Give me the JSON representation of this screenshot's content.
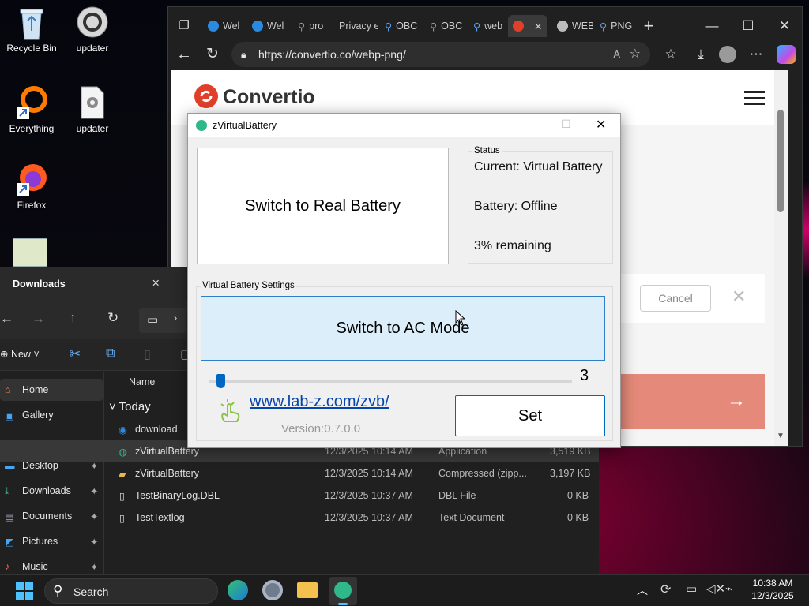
{
  "desktop": {
    "icons": [
      {
        "label": "Recycle Bin"
      },
      {
        "label": "updater"
      },
      {
        "label": "Everything"
      },
      {
        "label": "updater"
      },
      {
        "label": "Firefox"
      }
    ]
  },
  "browser": {
    "tabs": [
      {
        "label": "Wel"
      },
      {
        "label": "Wel"
      },
      {
        "label": "pro"
      },
      {
        "label": "Privacy e"
      },
      {
        "label": "OBC"
      },
      {
        "label": "OBC"
      },
      {
        "label": "web"
      },
      {
        "label": "WEB"
      },
      {
        "label": "PNG"
      }
    ],
    "url": "https://convertio.co/webp-png/",
    "page": {
      "brand": "Convertio",
      "cancel_label": "Cancel"
    }
  },
  "zvb": {
    "title": "zVirtualBattery",
    "switch_battery_label": "Switch to Real Battery",
    "status": {
      "group_label": "Status",
      "current": "Current: Virtual Battery",
      "battery": "Battery: Offline",
      "remaining": "3% remaining"
    },
    "settings": {
      "group_label": "Virtual Battery Settings",
      "switch_ac_label": "Switch to AC Mode",
      "slider_value": "3",
      "link": "www.lab-z.com/zvb/",
      "version": "Version:0.7.0.0",
      "set_label": "Set"
    }
  },
  "explorer": {
    "title": "Downloads",
    "new_label": "New",
    "column_name": "Name",
    "group_today": "Today",
    "nav": [
      {
        "label": "Home"
      },
      {
        "label": "Gallery"
      },
      {
        "label": "Desktop"
      },
      {
        "label": "Downloads"
      },
      {
        "label": "Documents"
      },
      {
        "label": "Pictures"
      },
      {
        "label": "Music"
      }
    ],
    "files": [
      {
        "name": "download",
        "date": "",
        "type": "",
        "size": ""
      },
      {
        "name": "zVirtualBattery",
        "date": "12/3/2025 10:14 AM",
        "type": "Application",
        "size": "3,519 KB"
      },
      {
        "name": "zVirtualBattery",
        "date": "12/3/2025 10:14 AM",
        "type": "Compressed (zipp...",
        "size": "3,197 KB"
      },
      {
        "name": "TestBinaryLog.DBL",
        "date": "12/3/2025 10:37 AM",
        "type": "DBL File",
        "size": "0 KB"
      },
      {
        "name": "TestTextlog",
        "date": "12/3/2025 10:37 AM",
        "type": "Text Document",
        "size": "0 KB"
      }
    ]
  },
  "taskbar": {
    "search_label": "Search",
    "time": "10:38 AM",
    "date": "12/3/2025"
  },
  "colors": {
    "accent_blue": "#0067c0",
    "ac_button_bg": "#dbeefa",
    "convertio_red": "#e0402a"
  }
}
